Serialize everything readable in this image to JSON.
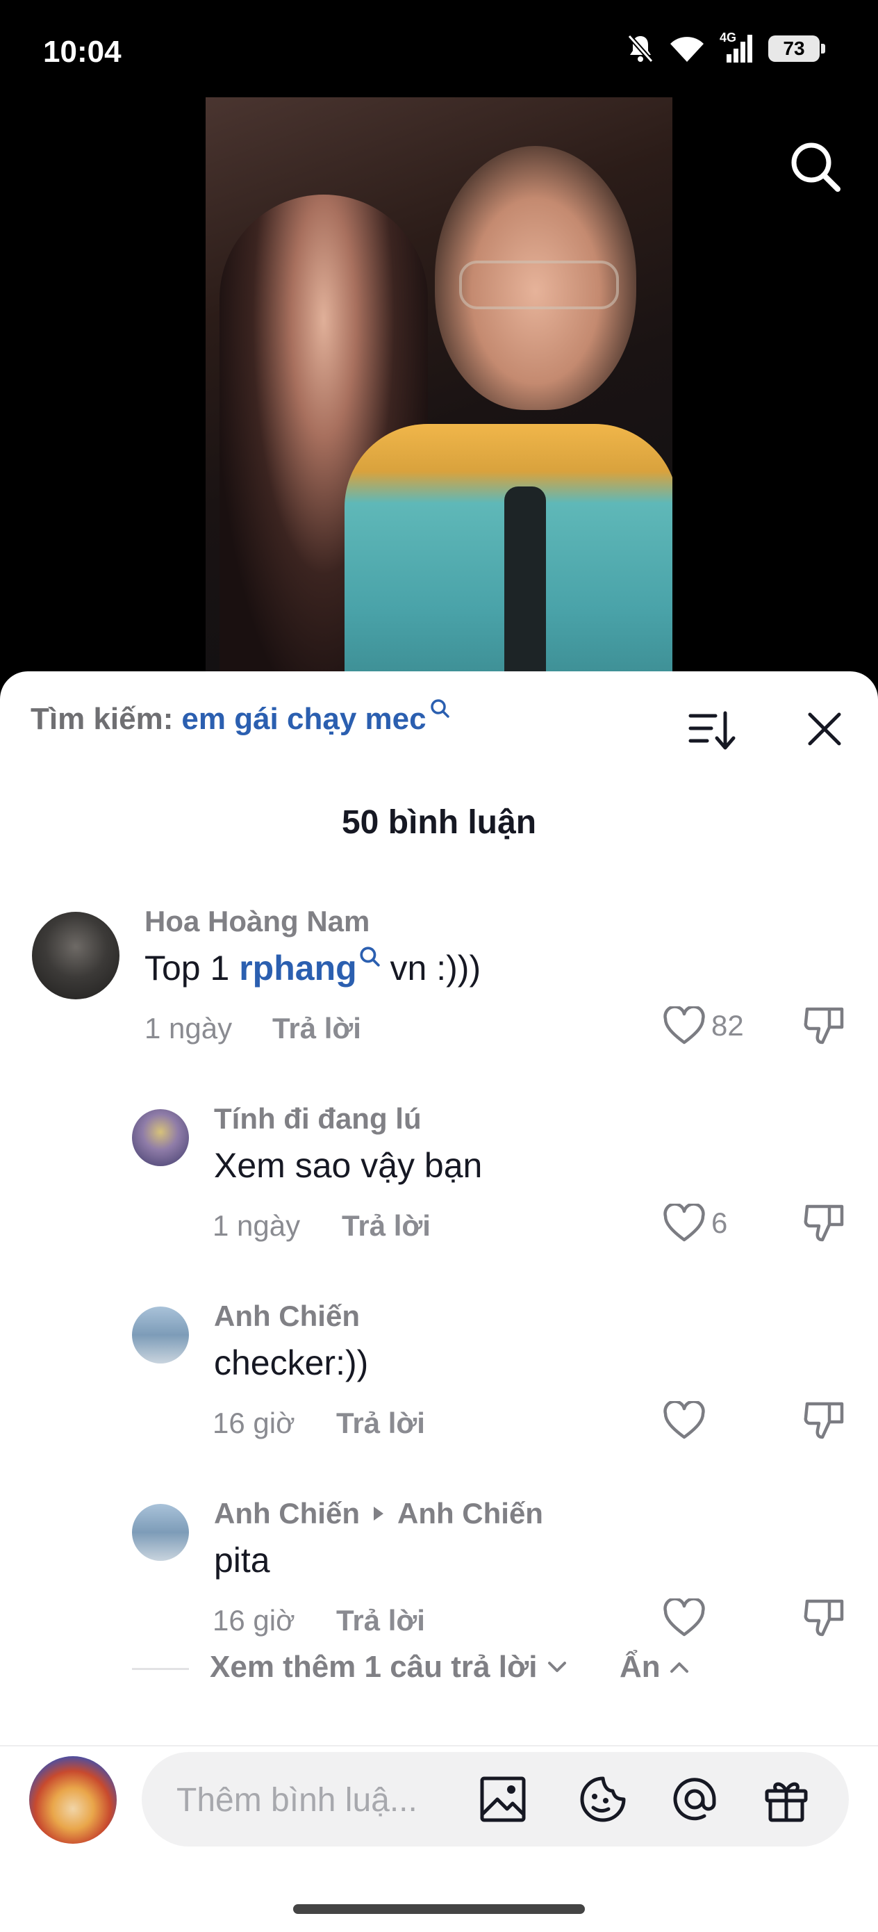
{
  "status_bar": {
    "time": "10:04",
    "network": "4G",
    "battery": "73",
    "icons": [
      "bell-muted-icon",
      "wifi-icon",
      "signal-icon",
      "battery-icon"
    ]
  },
  "search_header": {
    "label": "Tìm kiếm:",
    "query": "em gái chạy mec"
  },
  "comments_count": "50 bình luận",
  "comments": [
    {
      "name": "Hoa Hoàng Nam",
      "text_before": "Top 1 ",
      "mention": "rphang",
      "text_after": " vn :)))",
      "time": "1 ngày",
      "reply": "Trả lời",
      "likes": "82"
    },
    {
      "name": "Tính đi đang lú",
      "text": "Xem sao vậy bạn",
      "time": "1 ngày",
      "reply": "Trả lời",
      "likes": "6"
    },
    {
      "name": "Anh Chiến",
      "text": "checker:))",
      "time": "16 giờ",
      "reply": "Trả lời",
      "likes": ""
    },
    {
      "name": "Anh Chiến",
      "reply_to": "Anh Chiến",
      "text": "pita",
      "time": "16 giờ",
      "reply": "Trả lời",
      "likes": ""
    }
  ],
  "more_replies": "Xem thêm 1 câu trả lời",
  "hide": "Ẩn",
  "composer": {
    "placeholder": "Thêm bình luậ..."
  },
  "colors": {
    "link": "#2b5fb0",
    "muted": "#808085",
    "text": "#161823"
  }
}
